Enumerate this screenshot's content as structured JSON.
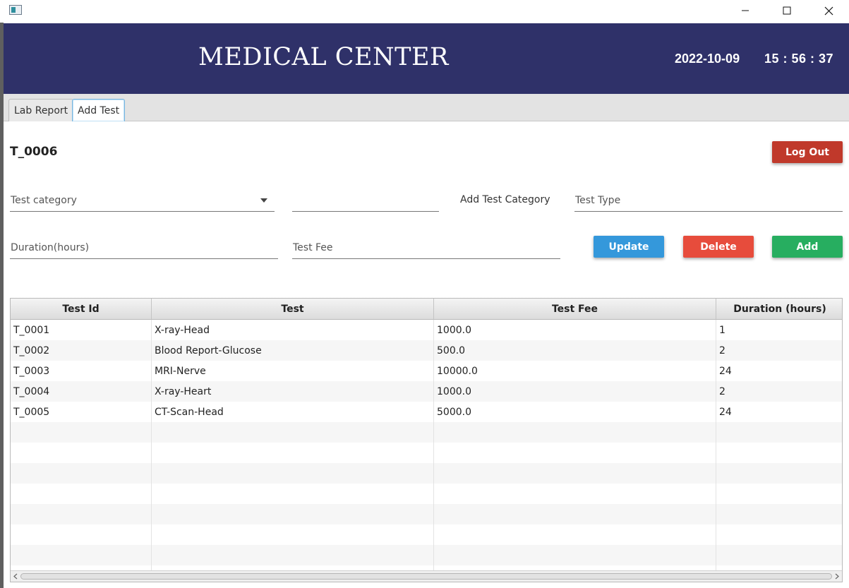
{
  "header": {
    "title": "MEDICAL CENTER",
    "date": "2022-10-09",
    "time": "15 : 56 : 37",
    "bg_color": "#2f3169"
  },
  "tabs": [
    {
      "label": "Lab Report",
      "active": false
    },
    {
      "label": "Add Test",
      "active": true
    }
  ],
  "form": {
    "test_id": "T_0006",
    "category_placeholder": "Test category",
    "new_category_value": "",
    "add_category_label": "Add Test Category",
    "test_type_placeholder": "Test Type",
    "duration_placeholder": "Duration(hours)",
    "fee_placeholder": "Test Fee"
  },
  "buttons": {
    "logout": {
      "label": "Log Out",
      "color": "#c0392b"
    },
    "update": {
      "label": "Update",
      "color": "#3498db"
    },
    "delete": {
      "label": "Delete",
      "color": "#e74c3c"
    },
    "add": {
      "label": "Add",
      "color": "#27ae60"
    }
  },
  "table": {
    "columns": [
      "Test Id",
      "Test",
      "Test Fee",
      "Duration (hours)"
    ],
    "rows": [
      [
        "T_0001",
        "X-ray-Head",
        "1000.0",
        "1"
      ],
      [
        "T_0002",
        "Blood Report-Glucose",
        "500.0",
        "2"
      ],
      [
        "T_0003",
        "MRI-Nerve",
        "10000.0",
        "24"
      ],
      [
        "T_0004",
        "X-ray-Heart",
        "1000.0",
        "2"
      ],
      [
        "T_0005",
        "CT-Scan-Head",
        "5000.0",
        "24"
      ]
    ],
    "empty_rows": 8
  }
}
